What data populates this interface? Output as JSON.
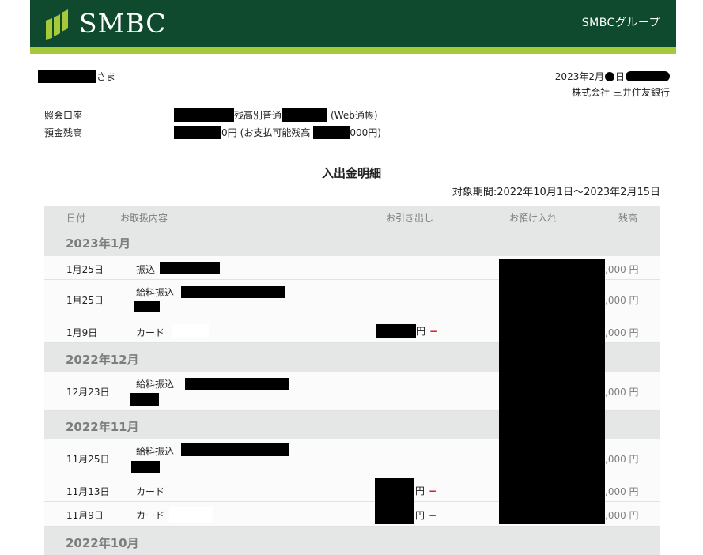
{
  "header": {
    "logo": "SMBC",
    "group": "SMBCグループ",
    "brand_green": "#0f4a2e",
    "stripe_green": "#a6c93a"
  },
  "customer": {
    "suffix": "さま"
  },
  "statement": {
    "date_prefix": "2023年2月",
    "date_day_suffix": "日",
    "bank": "株式会社 三井住友銀行"
  },
  "account": {
    "label": "照会口座",
    "branch_type": "残高別普通",
    "passbook": "(Web通帳)"
  },
  "balance": {
    "label": "預金残高",
    "amount_tail": "0円",
    "available_prefix": "(お支払可能残高",
    "available_tail": "000円)"
  },
  "title": "入出金明細",
  "period": "対象期間:2022年10月1日〜2023年2月15日",
  "columns": {
    "date": "日付",
    "description": "お取扱内容",
    "withdrawal": "お引き出し",
    "deposit": "お預け入れ",
    "balance": "残高"
  },
  "months": {
    "jan": "2023年1月",
    "dec": "2022年12月",
    "nov": "2022年11月",
    "oct": "2022年10月"
  },
  "rows": {
    "r1": {
      "date": "1月25日",
      "desc": "振込",
      "balance": ",000 円"
    },
    "r2": {
      "date": "1月25日",
      "desc": "給料振込",
      "balance": ",000 円"
    },
    "r3": {
      "date": "1月9日",
      "desc": "カード",
      "withdraw_yen": "円",
      "withdraw_sign": "−",
      "balance": ",000 円"
    },
    "r4": {
      "date": "12月23日",
      "desc": "給料振込",
      "balance": ",000 円"
    },
    "r5": {
      "date": "11月25日",
      "desc": "給料振込",
      "balance": ",000 円"
    },
    "r6": {
      "date": "11月13日",
      "desc": "カード",
      "withdraw_yen": "円",
      "withdraw_sign": "−",
      "balance": ",000 円"
    },
    "r7": {
      "date": "11月9日",
      "desc": "カード",
      "withdraw_yen": "円",
      "withdraw_sign": "−",
      "balance": ",000 円"
    }
  }
}
